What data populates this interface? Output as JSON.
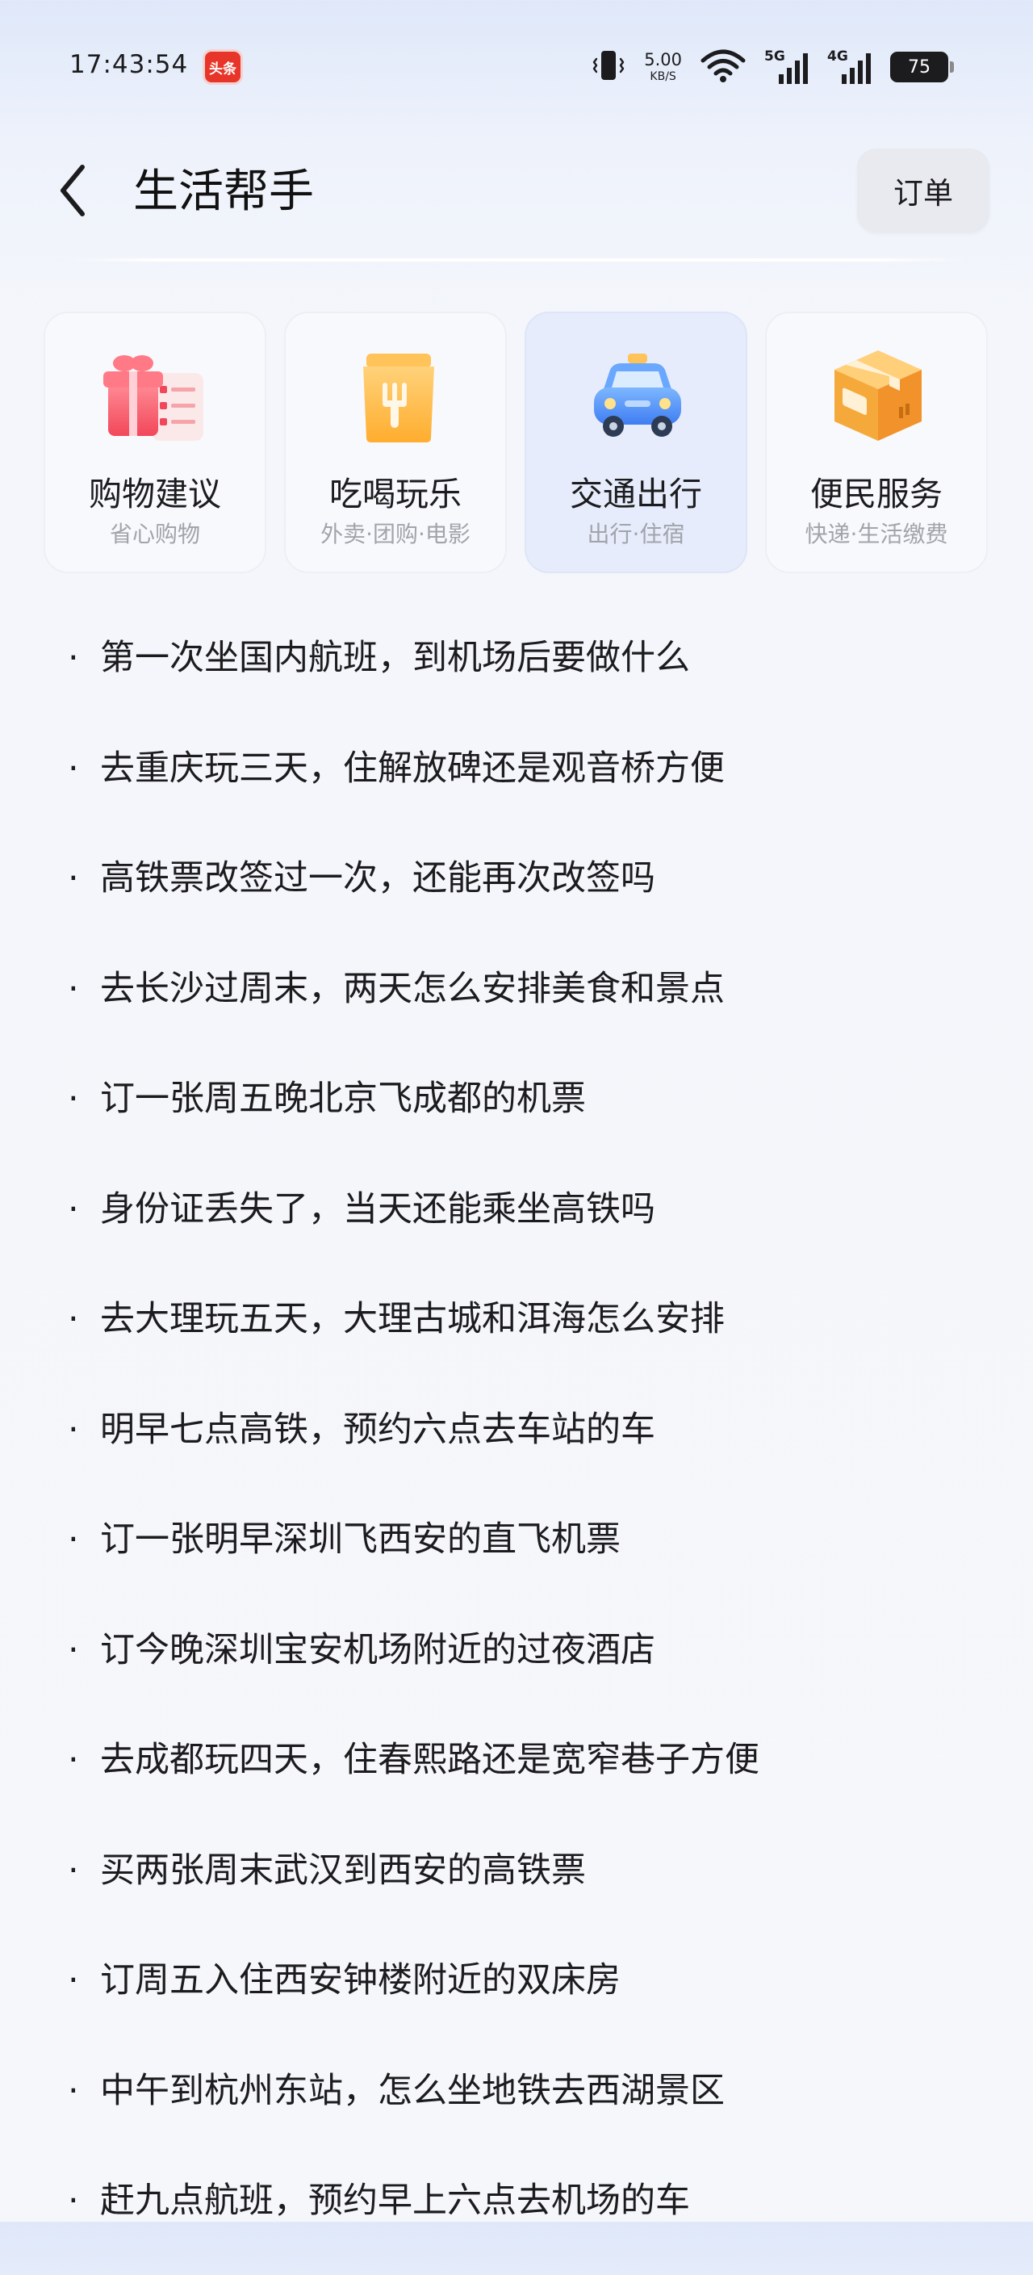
{
  "status_bar": {
    "time": "17:43:54",
    "app_badge": "头条",
    "speed_value": "5.00",
    "speed_unit": "KB/S",
    "network_5g": "5G",
    "network_4g": "4G",
    "battery_level": "75",
    "icons": [
      "vibrate-icon",
      "wifi-icon",
      "signal-5g-icon",
      "signal-4g-icon",
      "battery-icon"
    ]
  },
  "header": {
    "title": "生活帮手",
    "order_button": "订单",
    "back_icon": "chevron-left-icon"
  },
  "categories": [
    {
      "title": "购物建议",
      "subtitle": "省心购物",
      "icon": "gift-checklist-icon",
      "selected": false
    },
    {
      "title": "吃喝玩乐",
      "subtitle": "外卖·团购·电影",
      "icon": "takeout-bag-icon",
      "selected": false
    },
    {
      "title": "交通出行",
      "subtitle": "出行·住宿",
      "icon": "car-icon",
      "selected": true
    },
    {
      "title": "便民服务",
      "subtitle": "快递·生活缴费",
      "icon": "package-box-icon",
      "selected": false
    }
  ],
  "suggestions": [
    "第一次坐国内航班，到机场后要做什么",
    "去重庆玩三天，住解放碑还是观音桥方便",
    "高铁票改签过一次，还能再次改签吗",
    "去长沙过周末，两天怎么安排美食和景点",
    "订一张周五晚北京飞成都的机票",
    "身份证丢失了，当天还能乘坐高铁吗",
    "去大理玩五天，大理古城和洱海怎么安排",
    "明早七点高铁，预约六点去车站的车",
    "订一张明早深圳飞西安的直飞机票",
    "订今晚深圳宝安机场附近的过夜酒店",
    "去成都玩四天，住春熙路还是宽窄巷子方便",
    "买两张周末武汉到西安的高铁票",
    "订周五入住西安钟楼附近的双床房",
    "中午到杭州东站，怎么坐地铁去西湖景区",
    "赶九点航班，预约早上六点去机场的车"
  ],
  "bullet": "·"
}
